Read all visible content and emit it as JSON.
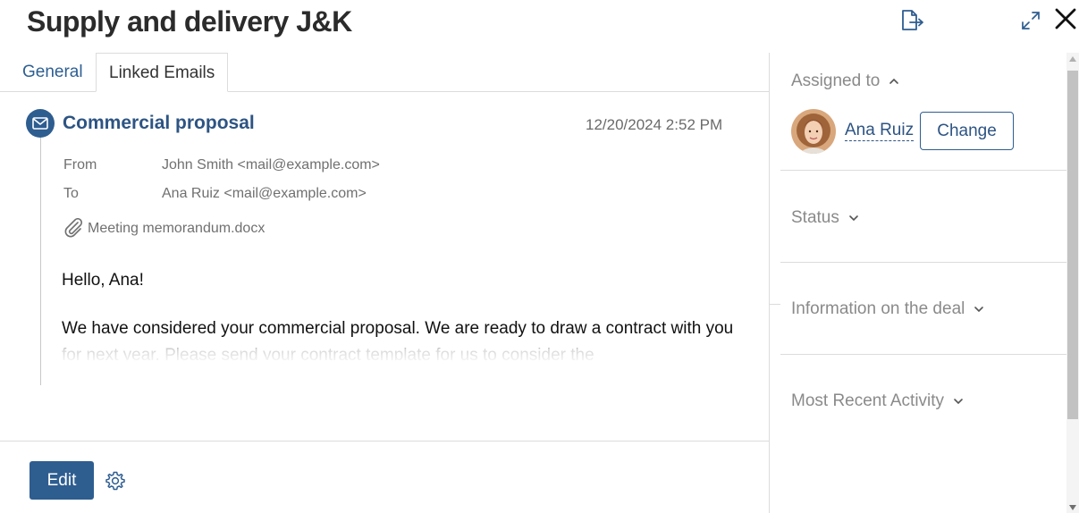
{
  "header": {
    "title": "Supply and delivery J&K",
    "icons": [
      "export-icon",
      "expand-icon",
      "close-icon"
    ]
  },
  "tabs": [
    {
      "label": "General",
      "active": false
    },
    {
      "label": "Linked Emails",
      "active": true
    }
  ],
  "email": {
    "subject": "Commercial proposal",
    "date": "12/20/2024 2:52 PM",
    "from_label": "From",
    "from_value": "John Smith <mail@example.com>",
    "to_label": "To",
    "to_value": "Ana Ruiz <mail@example.com>",
    "attachment": "Meeting memorandum.docx",
    "greeting": "Hello, Ana!",
    "body": "We have considered your commercial proposal. We are ready to draw a contract with you for next year. Please send your contract template for us to consider the"
  },
  "footer": {
    "edit_label": "Edit"
  },
  "sidebar": {
    "assigned_title": "Assigned to",
    "assignee_name": "Ana Ruiz",
    "change_label": "Change",
    "status_title": "Status",
    "deal_info_title": "Information on the deal",
    "recent_activity_title": "Most Recent Activity"
  },
  "colors": {
    "accent": "#2e5d90",
    "link": "#2d5483",
    "muted": "#8a8a8a"
  }
}
